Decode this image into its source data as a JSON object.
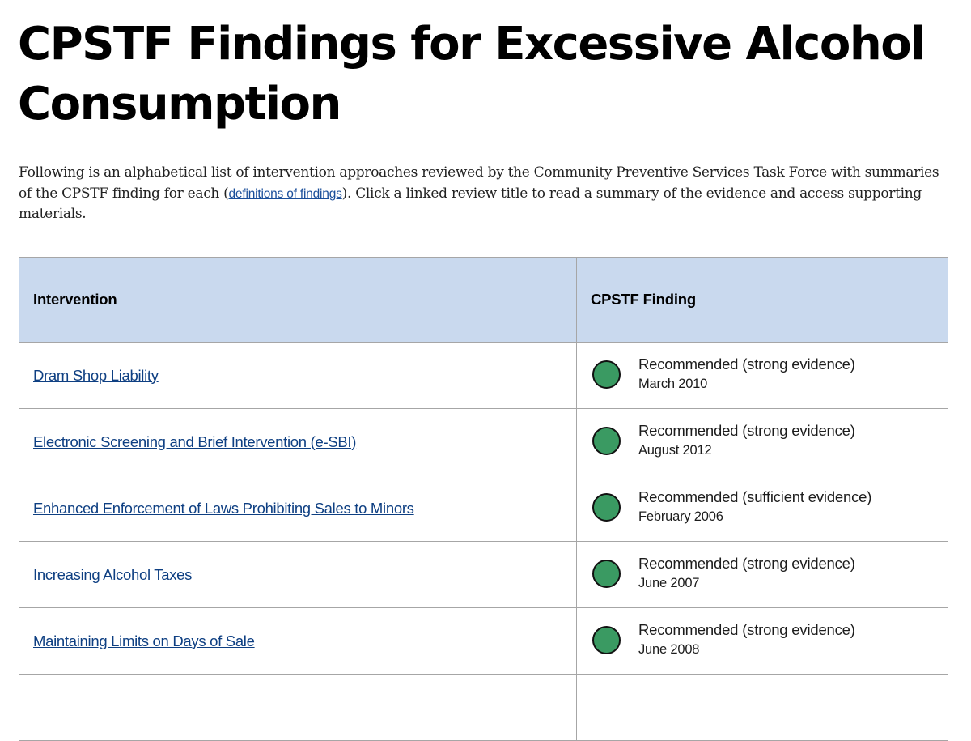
{
  "page": {
    "title": "CPSTF Findings for Excessive Alcohol Consumption",
    "intro": {
      "before_link": "Following is an alphabetical list of intervention approaches reviewed by the Community Preventive Services Task Force with summaries of the CPSTF finding for each (",
      "link_text": "definitions of findings",
      "after_link": "). Click a linked review title to read a summary of the evidence and access supporting materials."
    }
  },
  "table": {
    "headers": {
      "intervention": "Intervention",
      "finding": "CPSTF Finding"
    },
    "status_color": "#3a9a62",
    "rows": [
      {
        "intervention": "Dram Shop Liability",
        "finding": "Recommended (strong evidence)",
        "date": "March 2010",
        "status_icon": "green-circle-icon"
      },
      {
        "intervention": "Electronic Screening and Brief Intervention (e-SBI)",
        "finding": "Recommended (strong evidence)",
        "date": "August 2012",
        "status_icon": "green-circle-icon"
      },
      {
        "intervention": "Enhanced Enforcement of Laws Prohibiting Sales to Minors",
        "finding": "Recommended (sufficient evidence)",
        "date": "February 2006",
        "status_icon": "green-circle-icon"
      },
      {
        "intervention": "Increasing Alcohol Taxes",
        "finding": "Recommended (strong evidence)",
        "date": "June 2007",
        "status_icon": "green-circle-icon"
      },
      {
        "intervention": "Maintaining Limits on Days of Sale",
        "finding": "Recommended (strong evidence)",
        "date": "June 2008",
        "status_icon": "green-circle-icon"
      }
    ]
  }
}
